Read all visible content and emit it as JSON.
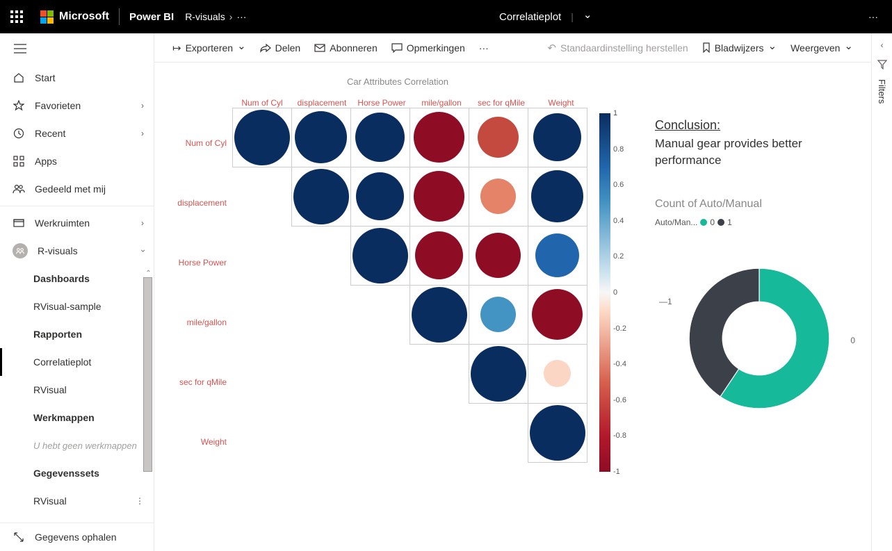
{
  "header": {
    "brand": "Microsoft",
    "product": "Power BI",
    "breadcrumb": "R-visuals",
    "report_name": "Correlatieplot"
  },
  "nav": {
    "start": "Start",
    "favorieten": "Favorieten",
    "recent": "Recent",
    "apps": "Apps",
    "gedeeld": "Gedeeld met mij",
    "werkruimten": "Werkruimten",
    "rvisuals": "R-visuals",
    "dashboards": "Dashboards",
    "rvisual_sample": "RVisual-sample",
    "rapporten": "Rapporten",
    "correlatieplot": "Correlatieplot",
    "rvisual": "RVisual",
    "werkmappen": "Werkmappen",
    "no_workbooks": "U hebt geen werkmappen",
    "gegevenssets": "Gegevenssets",
    "rvisual2": "RVisual",
    "get_data": "Gegevens ophalen"
  },
  "toolbar": {
    "exporteren": "Exporteren",
    "delen": "Delen",
    "abonneren": "Abonneren",
    "opmerkingen": "Opmerkingen",
    "reset": "Standaardinstelling herstellen",
    "bladwijzers": "Bladwijzers",
    "weergeven": "Weergeven"
  },
  "chart_data": {
    "correlation": {
      "type": "heatmap",
      "title": "Car Attributes Correlation",
      "variables": [
        "Num of Cyl",
        "displacement",
        "Horse Power",
        "mile/gallon",
        "sec for qMile",
        "Weight"
      ],
      "matrix": [
        [
          1.0,
          0.9,
          0.83,
          -0.85,
          -0.59,
          0.78
        ],
        [
          null,
          1.0,
          0.79,
          -0.85,
          -0.43,
          0.89
        ],
        [
          null,
          null,
          1.0,
          -0.78,
          -0.71,
          0.66
        ],
        [
          null,
          null,
          null,
          1.0,
          0.42,
          -0.87
        ],
        [
          null,
          null,
          null,
          null,
          1.0,
          -0.17
        ],
        [
          null,
          null,
          null,
          null,
          null,
          1.0
        ]
      ],
      "scale_ticks": [
        "1",
        "0.8",
        "0.6",
        "0.4",
        "0.2",
        "0",
        "-0.2",
        "-0.4",
        "-0.6",
        "-0.8",
        "-1"
      ]
    },
    "donut": {
      "type": "pie",
      "title": "Count of Auto/Manual",
      "legend_label": "Auto/Man...",
      "series": [
        {
          "name": "0",
          "value": 19,
          "color": "#16b99a"
        },
        {
          "name": "1",
          "value": 13,
          "color": "#3c4049"
        }
      ]
    }
  },
  "conclusion": {
    "title": "Conclusion:",
    "text": "Manual gear provides better performance"
  },
  "filters": {
    "label": "Filters"
  }
}
